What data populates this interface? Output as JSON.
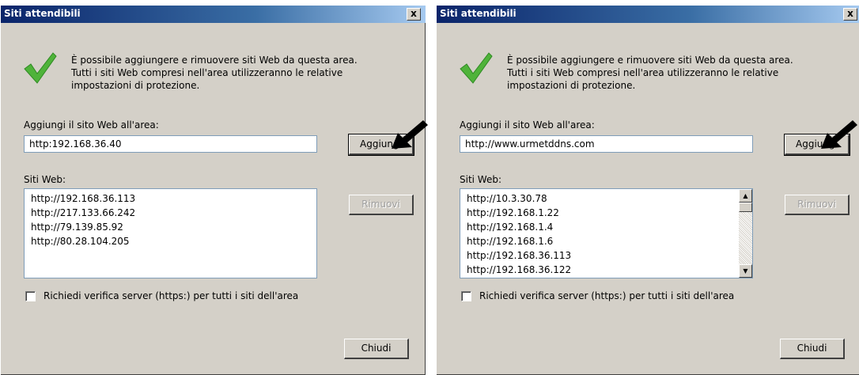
{
  "left": {
    "title": "Siti attendibili",
    "close_symbol": "x",
    "intro_line1": "È possibile aggiungere e rimuovere siti Web da questa area.",
    "intro_line2": "Tutti i siti Web compresi nell'area utilizzeranno le relative",
    "intro_line3": "impostazioni di protezione.",
    "add_label": "Aggiungi il sito Web all'area:",
    "add_value": "http:192.168.36.40",
    "add_button": "Aggiungi",
    "sites_label": "Siti Web:",
    "sites": [
      "http://192.168.36.113",
      "http://217.133.66.242",
      "http://79.139.85.92",
      "http://80.28.104.205"
    ],
    "remove_button": "Rimuovi",
    "https_label": "Richiedi verifica server (https:) per tutti i siti dell'area",
    "close_button": "Chiudi"
  },
  "right": {
    "title": "Siti attendibili",
    "close_symbol": "x",
    "intro_line1": "È possibile aggiungere e rimuovere siti Web da questa area.",
    "intro_line2": "Tutti i siti Web compresi nell'area utilizzeranno le relative",
    "intro_line3": "impostazioni di protezione.",
    "add_label": "Aggiungi il sito Web all'area:",
    "add_value": "http://www.urmetddns.com",
    "add_button": "Aggiungi",
    "sites_label": "Siti Web:",
    "sites": [
      "http://10.3.30.78",
      "http://192.168.1.22",
      "http://192.168.1.4",
      "http://192.168.1.6",
      "http://192.168.36.113",
      "http://192.168.36.122"
    ],
    "remove_button": "Rimuovi",
    "https_label": "Richiedi verifica server (https:) per tutti i siti dell'area",
    "close_button": "Chiudi"
  },
  "icons": {
    "check": "check-icon",
    "pointer": "arrow-pointer-icon",
    "close": "close-icon"
  },
  "colors": {
    "titlebar": "#0a246a",
    "dialog": "#d4d0c8",
    "check": "#4fb33a"
  }
}
